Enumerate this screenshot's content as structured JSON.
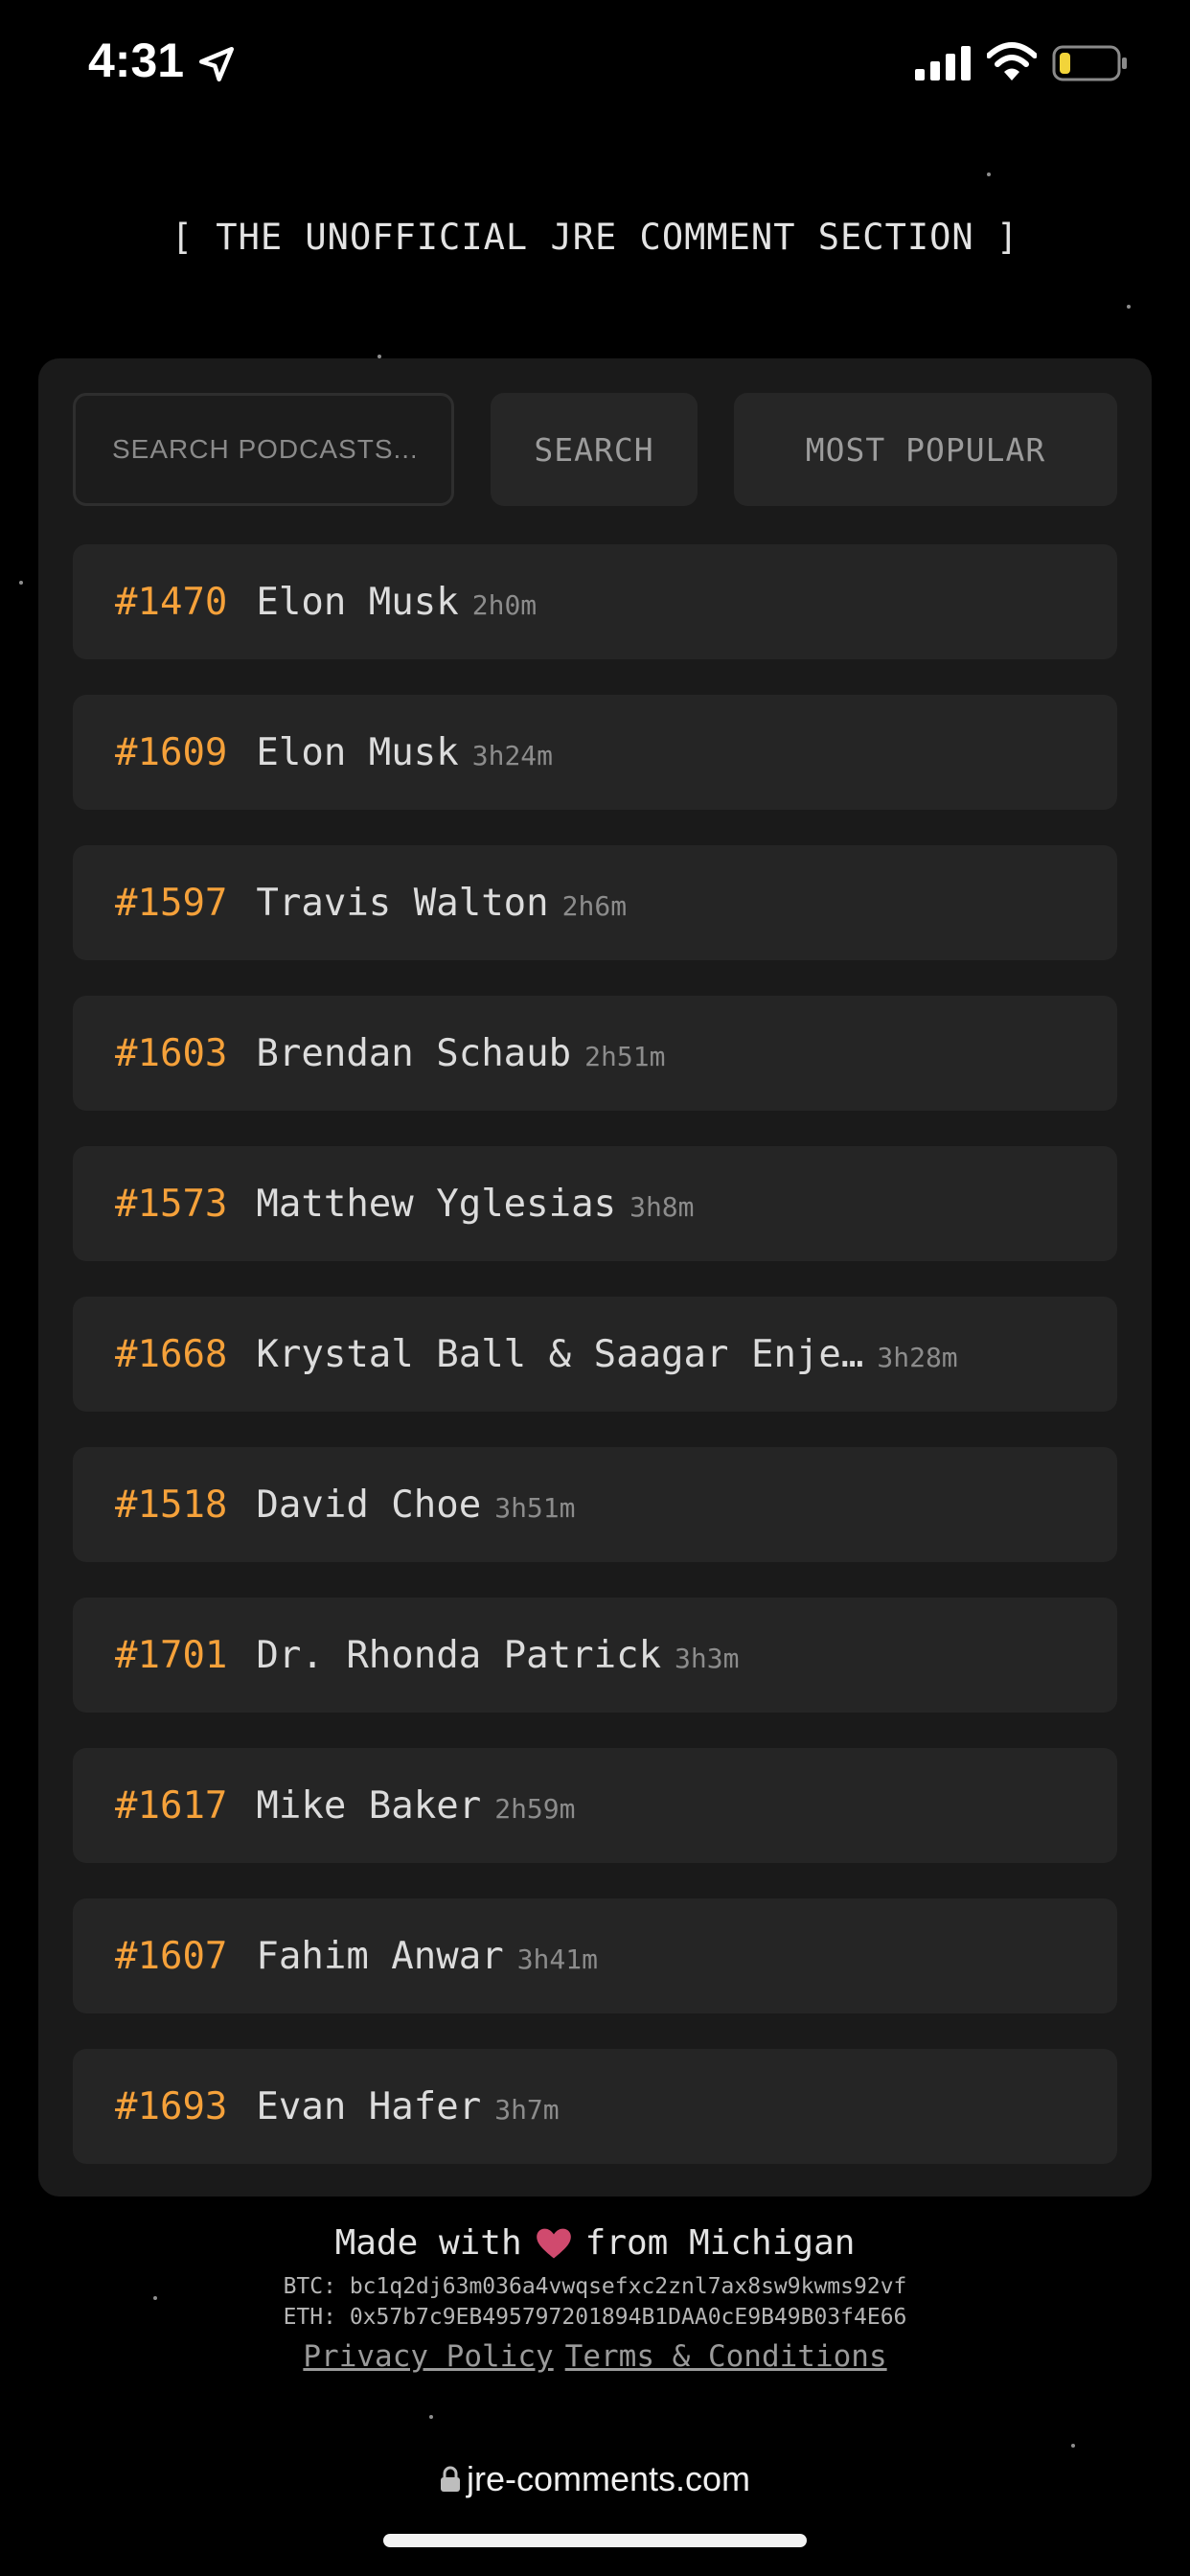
{
  "status_bar": {
    "time": "4:31"
  },
  "site": {
    "title": "[ THE UNOFFICIAL JRE COMMENT SECTION ]"
  },
  "search": {
    "placeholder": "SEARCH PODCASTS...",
    "button_label": "SEARCH",
    "popular_label": "MOST POPULAR"
  },
  "episodes": [
    {
      "number": "#1470",
      "guest": "Elon Musk",
      "duration": "2h0m"
    },
    {
      "number": "#1609",
      "guest": "Elon Musk",
      "duration": "3h24m"
    },
    {
      "number": "#1597",
      "guest": "Travis Walton",
      "duration": "2h6m"
    },
    {
      "number": "#1603",
      "guest": "Brendan Schaub",
      "duration": "2h51m"
    },
    {
      "number": "#1573",
      "guest": "Matthew Yglesias",
      "duration": "3h8m"
    },
    {
      "number": "#1668",
      "guest": "Krystal Ball & Saagar Enje…",
      "duration": "3h28m"
    },
    {
      "number": "#1518",
      "guest": "David Choe",
      "duration": "3h51m"
    },
    {
      "number": "#1701",
      "guest": "Dr. Rhonda Patrick",
      "duration": "3h3m"
    },
    {
      "number": "#1617",
      "guest": "Mike Baker",
      "duration": "2h59m"
    },
    {
      "number": "#1607",
      "guest": "Fahim Anwar",
      "duration": "3h41m"
    },
    {
      "number": "#1693",
      "guest": "Evan Hafer",
      "duration": "3h7m"
    }
  ],
  "footer": {
    "made_with_prefix": "Made with",
    "made_with_suffix": "from Michigan",
    "btc": "BTC: bc1q2dj63m036a4vwqsefxc2znl7ax8sw9kwms92vf",
    "eth": "ETH: 0x57b7c9EB495797201894B1DAA0cE9B49B03f4E66",
    "privacy_label": "Privacy Policy",
    "terms_label": "Terms & Conditions"
  },
  "browser": {
    "url": "jre-comments.com"
  },
  "colors": {
    "background": "#000000",
    "panel": "#1a1a1a",
    "row": "#252525",
    "accent_orange": "#f5a13a",
    "heart": "#d04a6e"
  },
  "icons": [
    "location-arrow-icon",
    "signal-icon",
    "wifi-icon",
    "battery-icon",
    "heart-icon",
    "lock-icon"
  ]
}
